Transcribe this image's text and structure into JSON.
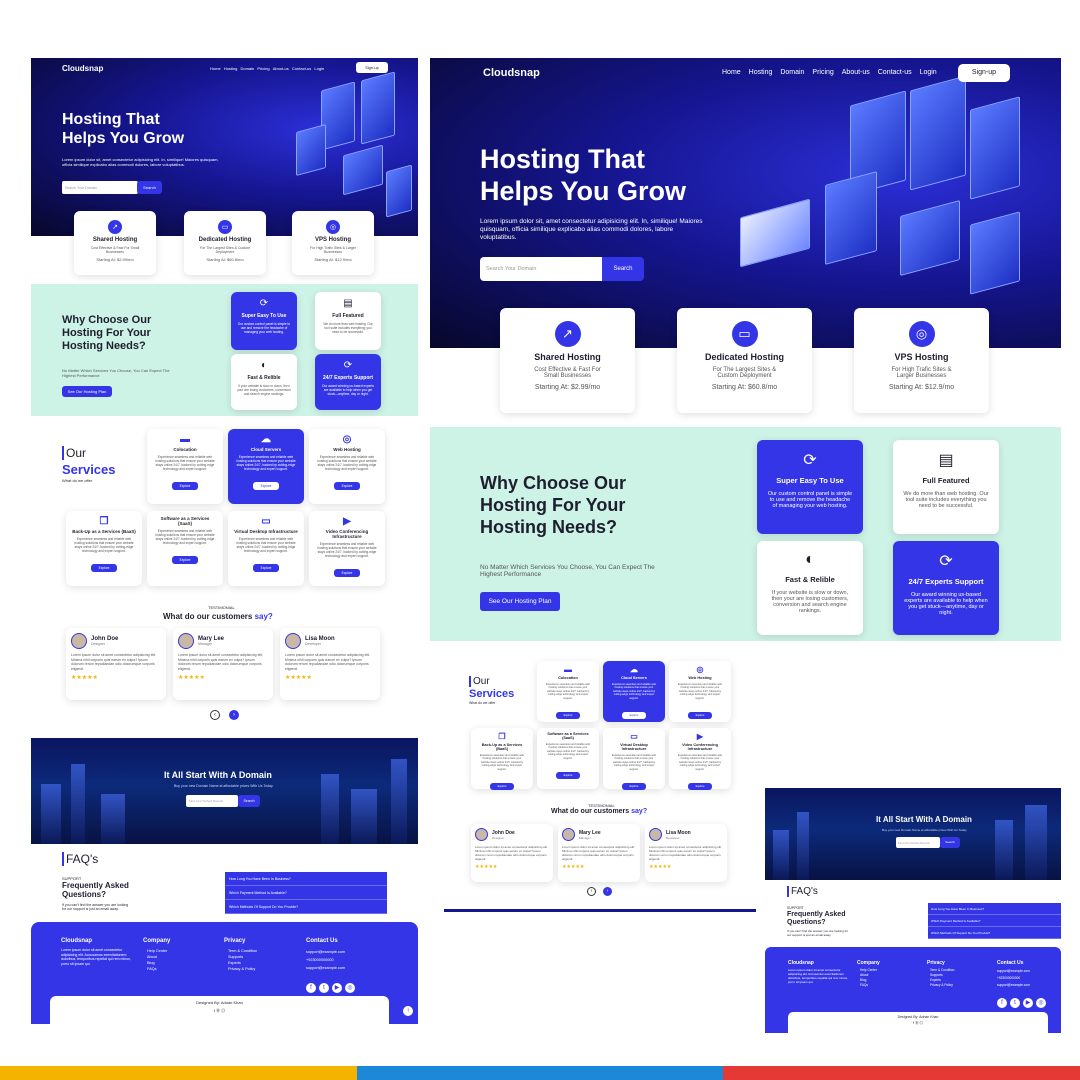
{
  "brand": "Cloudsnap",
  "nav": [
    "Home",
    "Hosting",
    "Domain",
    "Pricing",
    "About-us",
    "Contact-us",
    "Login"
  ],
  "signup": "Sign-up",
  "hero": {
    "title1": "Hosting That",
    "title2": "Helps You Grow",
    "desc": "Lorem ipsum dolor sit, amet consectetur adipisicing elit. In, similique! Maiores quisquam, officia similique explicabo alias commodi dolores, labore voluptatibus.",
    "search_placeholder": "Search Your Domain",
    "search_btn": "Search"
  },
  "plans": [
    {
      "title": "Shared Hosting",
      "desc": "Cost Effective & Fast For Small Businesses",
      "price": "Starting At: $2.99/mo"
    },
    {
      "title": "Dedicated Hosting",
      "desc": "For The Largest Sites & Custom Deployment",
      "price": "Starting At: $60.8/mo"
    },
    {
      "title": "VPS Hosting",
      "desc": "For High Trafic Sites & Larger Businesses",
      "price": "Starting At: $12.9/mo"
    }
  ],
  "why": {
    "title": "Why Choose Our Hosting For Your Hosting Needs?",
    "desc": "No Matter Which Services You Choose, You Can Expect The Highest Performance",
    "btn": "See Our Hosting Plan",
    "features": [
      {
        "title": "Super Easy To Use",
        "desc": "Our custom control panel is simple to use and remove the headache of managing your web hosting."
      },
      {
        "title": "Full Featured",
        "desc": "We do more than web hosting. Our tool suite includes everything you need to be successful."
      },
      {
        "title": "Fast & Relible",
        "desc": "If your website is slow or down, then your are losing customers, conversion and search engine rankings."
      },
      {
        "title": "24/7 Experts Support",
        "desc": "Our award winning us-based experts are available to help when you get stuck—anytime, day or night."
      }
    ]
  },
  "services": {
    "our": "Our",
    "title": "Services",
    "sub": "What do we offer",
    "items": [
      "Colocation",
      "Cloud Servers",
      "Web Hosting",
      "Back-Up as a Services (BaaS)",
      "Software as a Services (SaaS)",
      "Virtual Desktop Infrastructure",
      "Video Conferencing Infrastructure"
    ],
    "desc": "Experience seamless and reliable web hosting solutions that ensure your website stays online 24/7, backed by cutting-edge technology and expert support.",
    "btn": "Explore"
  },
  "testimonial": {
    "tag": "TESTIMONIAL",
    "title_a": "What do our customers",
    "title_b": "say?",
    "people": [
      {
        "name": "John Doe",
        "role": "Designer"
      },
      {
        "name": "Mary Lee",
        "role": "Manager"
      },
      {
        "name": "Lisa Moon",
        "role": "Developer"
      }
    ],
    "text": "Lorem ipsum dolor sit amet consectetur adipisicing elit. Minima nihil corporis quis earum ex culpa? Ipsum dolorum rerum repudiandae odio dolorumque corporis eligendi.",
    "stars": "★★★★★"
  },
  "domain": {
    "title": "It All Start With A Domain",
    "desc": "Buy your new Domain Name at affordable prices With Us Today",
    "placeholder": "Find Your Perfect Domain",
    "btn": "Search"
  },
  "faq": {
    "title": "FAQ's",
    "tag": "SUPPORT",
    "heading": "Frequently Asked Questions?",
    "desc": "If you can't find the answer you are looking for our support is just an email away.",
    "items": [
      "How Long You Have Been In Business?",
      "Which Payment Method Is Available?",
      "Which Methods Of Support Do You Provide?"
    ]
  },
  "footer": {
    "brand": "Cloudsnap",
    "about": "Lorem ipsum dolor sit amet consectetur adipisicing elit. Accusamus exercitationem doloribus, temporibus repellat qui rem minus, porro sit ipsam qui.",
    "company_title": "Company",
    "company": [
      "Help Center",
      "About",
      "Blog",
      "FAQs"
    ],
    "privacy_title": "Privacy",
    "privacy": [
      "Term & Condition",
      "Supports",
      "Experts",
      "Privacy & Policy"
    ],
    "contact_title": "Contact Us",
    "contact": [
      "support@example.com",
      "+923000000000",
      "support@example.com"
    ],
    "designed": "Designed By: Adnan Khan"
  }
}
